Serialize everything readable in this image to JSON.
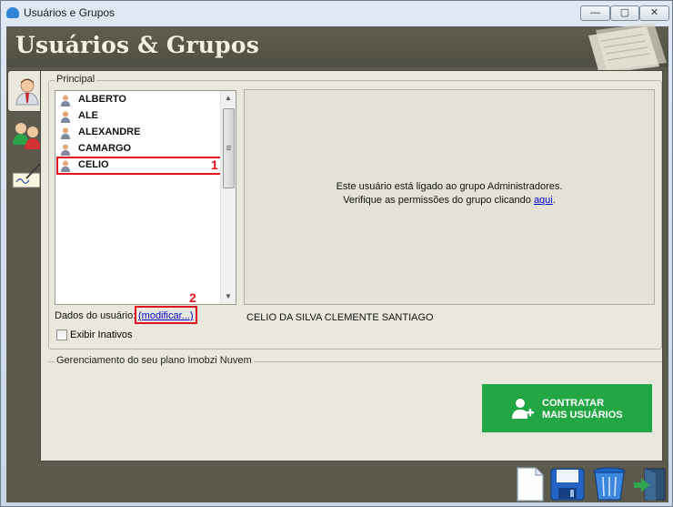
{
  "window": {
    "title": "Usuários e Grupos",
    "minimize": "—",
    "maximize": "▢",
    "close": "✕"
  },
  "header": {
    "title": "Usuários & Grupos"
  },
  "tabs": [
    {
      "icon": "user-icon",
      "active": true
    },
    {
      "icon": "users-group-icon",
      "active": false
    },
    {
      "icon": "signature-icon",
      "active": false
    }
  ],
  "principal": {
    "legend": "Principal",
    "users": [
      "ALBERTO",
      "ALE",
      "ALEXANDRE",
      "CAMARGO",
      "CELIO"
    ],
    "selected_user": "CELIO",
    "marker_1": "1",
    "info_line1": "Este usuário está ligado ao grupo Administradores.",
    "info_line2_prefix": "Verifique as permissões do grupo clicando ",
    "info_link": "aqui",
    "info_line2_suffix": ".",
    "dados_label": "Dados do usuário:",
    "modificar_link": "(modificar...)",
    "marker_2": "2",
    "full_name": "CELIO DA SILVA CLEMENTE SANTIAGO",
    "exibir_inativos": "Exibir Inativos",
    "exibir_inativos_checked": false
  },
  "plan": {
    "legend": "Gerenciamento do seu plano Imobzi Nuvem",
    "button_line1": "CONTRATAR",
    "button_line2": "MAIS USUÁRIOS",
    "button_color": "#23a745"
  },
  "toolbar": [
    "new-document-icon",
    "save-icon",
    "trash-icon",
    "exit-door-icon"
  ]
}
